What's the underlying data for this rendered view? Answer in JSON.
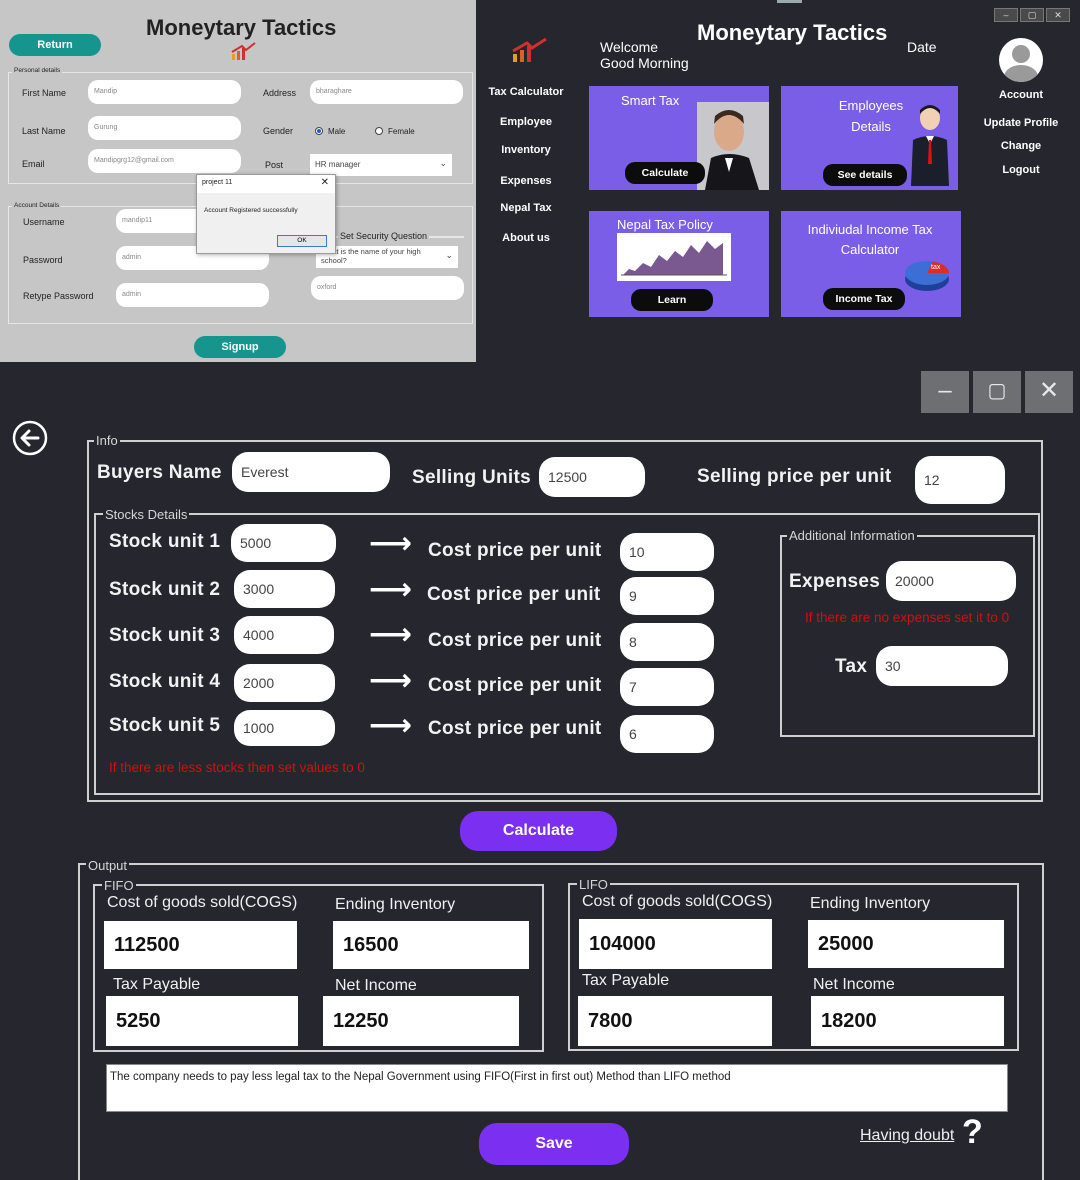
{
  "signup": {
    "title": "Moneytary Tactics",
    "return_label": "Return",
    "personal_caption": "Personal details",
    "first_name_label": "First Name",
    "first_name_value": "Mandip",
    "last_name_label": "Last Name",
    "last_name_value": "Gurung",
    "email_label": "Email",
    "email_value": "Mandipgrg12@gmail.com",
    "address_label": "Address",
    "address_value": "bharaghare",
    "gender_label": "Gender",
    "gender_male": "Male",
    "gender_female": "Female",
    "post_label": "Post",
    "post_value": "HR manager",
    "account_caption": "Account Details",
    "username_label": "Username",
    "username_value": "mandip11",
    "password_label": "Password",
    "password_value": "admin",
    "retype_label": "Retype Password",
    "retype_value": "admin",
    "security_caption": "Set Security Question",
    "security_question": "What is the name of your high school?",
    "security_answer": "oxford",
    "signup_label": "Signup",
    "dialog": {
      "title": "project 11",
      "close": "✕",
      "message": "Account Registered successfully",
      "ok": "OK"
    }
  },
  "dashboard": {
    "title": "Moneytary Tactics",
    "welcome": "Welcome",
    "greeting": "Good Morning",
    "date_label": "Date",
    "sidebar": [
      "Tax Calculator",
      "Employee",
      "Inventory",
      "Expenses",
      "Nepal Tax",
      "About us"
    ],
    "account_label": "Account",
    "account_menu": [
      "Update Profile",
      "Change",
      "Logout"
    ],
    "window_buttons": [
      "–",
      "▢",
      "✕"
    ],
    "cards": [
      {
        "title": "Smart Tax",
        "button": "Calculate"
      },
      {
        "title": "Employees Details",
        "button": "See details"
      },
      {
        "title": "Nepal Tax Policy",
        "button": "Learn"
      },
      {
        "title": "Indiviudal Income Tax Calculator",
        "button": "Income Tax"
      }
    ],
    "pie_label": "tax"
  },
  "calculator": {
    "window_buttons": [
      "–",
      "▢",
      "✕"
    ],
    "info_caption": "Info",
    "buyers_name_label": "Buyers Name",
    "buyers_name_value": "Everest",
    "selling_units_label": "Selling Units",
    "selling_units_value": "12500",
    "selling_price_label": "Selling price per unit",
    "selling_price_value": "12",
    "stocks_caption": "Stocks Details",
    "stocks": [
      {
        "label": "Stock unit 1",
        "units": "5000",
        "cost_label": "Cost price per unit",
        "cost": "10"
      },
      {
        "label": "Stock unit 2",
        "units": "3000",
        "cost_label": "Cost price per unit",
        "cost": "9"
      },
      {
        "label": "Stock unit 3",
        "units": "4000",
        "cost_label": "Cost price per unit",
        "cost": "8"
      },
      {
        "label": "Stock unit 4",
        "units": "2000",
        "cost_label": "Cost price per unit",
        "cost": "7"
      },
      {
        "label": "Stock unit 5",
        "units": "1000",
        "cost_label": "Cost price per unit",
        "cost": "6"
      }
    ],
    "arrow": "⟶",
    "stocks_hint": "If there are less stocks then set values to 0",
    "additional_caption": "Additional Information",
    "expenses_label": "Expenses",
    "expenses_value": "20000",
    "expenses_hint": "If there are no expenses set it to 0",
    "tax_label": "Tax",
    "tax_value": "30",
    "calculate_label": "Calculate",
    "output_caption": "Output",
    "fifo": {
      "caption": "FIFO",
      "cogs_label": "Cost of goods sold(COGS)",
      "cogs": "112500",
      "ending_label": "Ending Inventory",
      "ending": "16500",
      "tax_label": "Tax Payable",
      "tax": "5250",
      "net_label": "Net Income",
      "net": "12250"
    },
    "lifo": {
      "caption": "LIFO",
      "cogs_label": "Cost of goods sold(COGS)",
      "cogs": "104000",
      "ending_label": "Ending Inventory",
      "ending": "25000",
      "tax_label": "Tax Payable",
      "tax": "7800",
      "net_label": "Net Income",
      "net": "18200"
    },
    "conclusion": "The company needs to pay less legal tax to the Nepal Government using FIFO(First in first out) Method than LIFO method",
    "save_label": "Save",
    "doubt_label": "Having doubt",
    "doubt_mark": "?",
    "colors": {
      "accent": "#7b2ff0",
      "card": "#7b5ee8",
      "return": "#16958f",
      "hint": "#d11010"
    }
  }
}
